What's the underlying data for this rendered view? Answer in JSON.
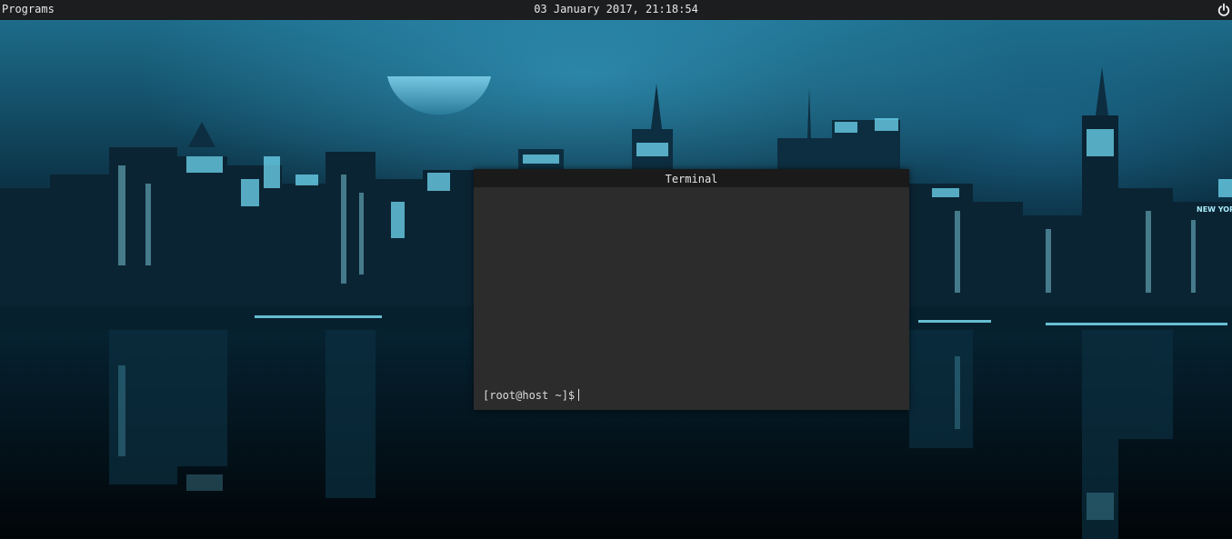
{
  "topbar": {
    "menu_label": "Programs",
    "clock": "03 January 2017, 21:18:54",
    "power_icon": "power-icon"
  },
  "wallpaper": {
    "description_icon": "city-skyline-wallpaper",
    "sign_text": "NEW YORKER"
  },
  "terminal": {
    "title": "Terminal",
    "prompt": "[root@host ~]$"
  },
  "colors": {
    "topbar_bg": "#1b1d1f",
    "terminal_bg": "#2c2c2c",
    "terminal_titlebar_bg": "#1a1a1a",
    "accent_cyan": "#5fd7f0"
  }
}
